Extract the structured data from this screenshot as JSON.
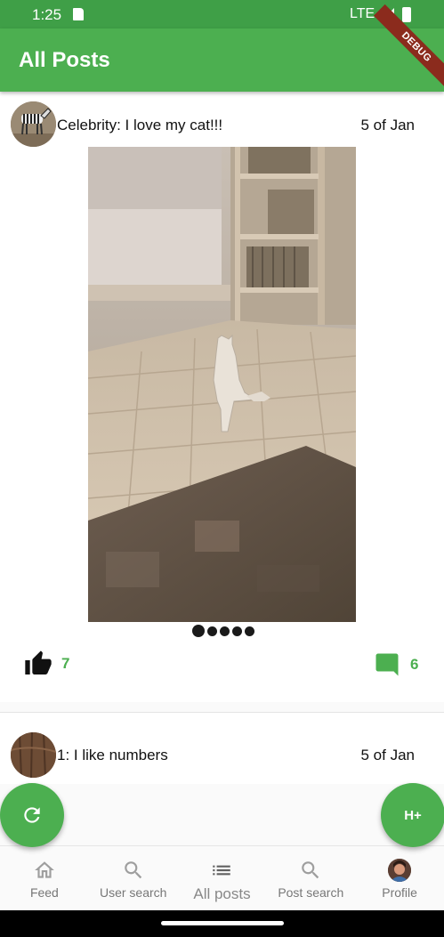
{
  "status_bar": {
    "time": "1:25",
    "network": "LTE",
    "icons": [
      "sd-card-icon",
      "signal-icon",
      "battery-icon"
    ]
  },
  "app_bar": {
    "title": "All Posts",
    "debug_banner": "DEBUG",
    "color": "#4caf50"
  },
  "posts": [
    {
      "title": "Celebrity: I love my cat!!!",
      "date": "5 of Jan",
      "avatar": "zebra-avatar",
      "image": "cat-room-photo",
      "carousel": {
        "total": 5,
        "active": 0
      },
      "likes": "7",
      "comments": "6"
    },
    {
      "title": "1: I like numbers",
      "date": "5 of Jan",
      "avatar": "wood-avatar"
    }
  ],
  "fabs": {
    "refresh_icon": "refresh-icon",
    "add_label": "H+"
  },
  "bottom_nav": {
    "items": [
      {
        "label": "Feed",
        "icon": "home-icon"
      },
      {
        "label": "User search",
        "icon": "search-icon"
      },
      {
        "label": "All posts",
        "icon": "list-icon",
        "active": true
      },
      {
        "label": "Post search",
        "icon": "search-icon"
      },
      {
        "label": "Profile",
        "icon": "profile-avatar"
      }
    ]
  },
  "colors": {
    "accent": "#4caf50",
    "status_bar": "#3f9f47",
    "icon_inactive": "#9e9e9e"
  }
}
